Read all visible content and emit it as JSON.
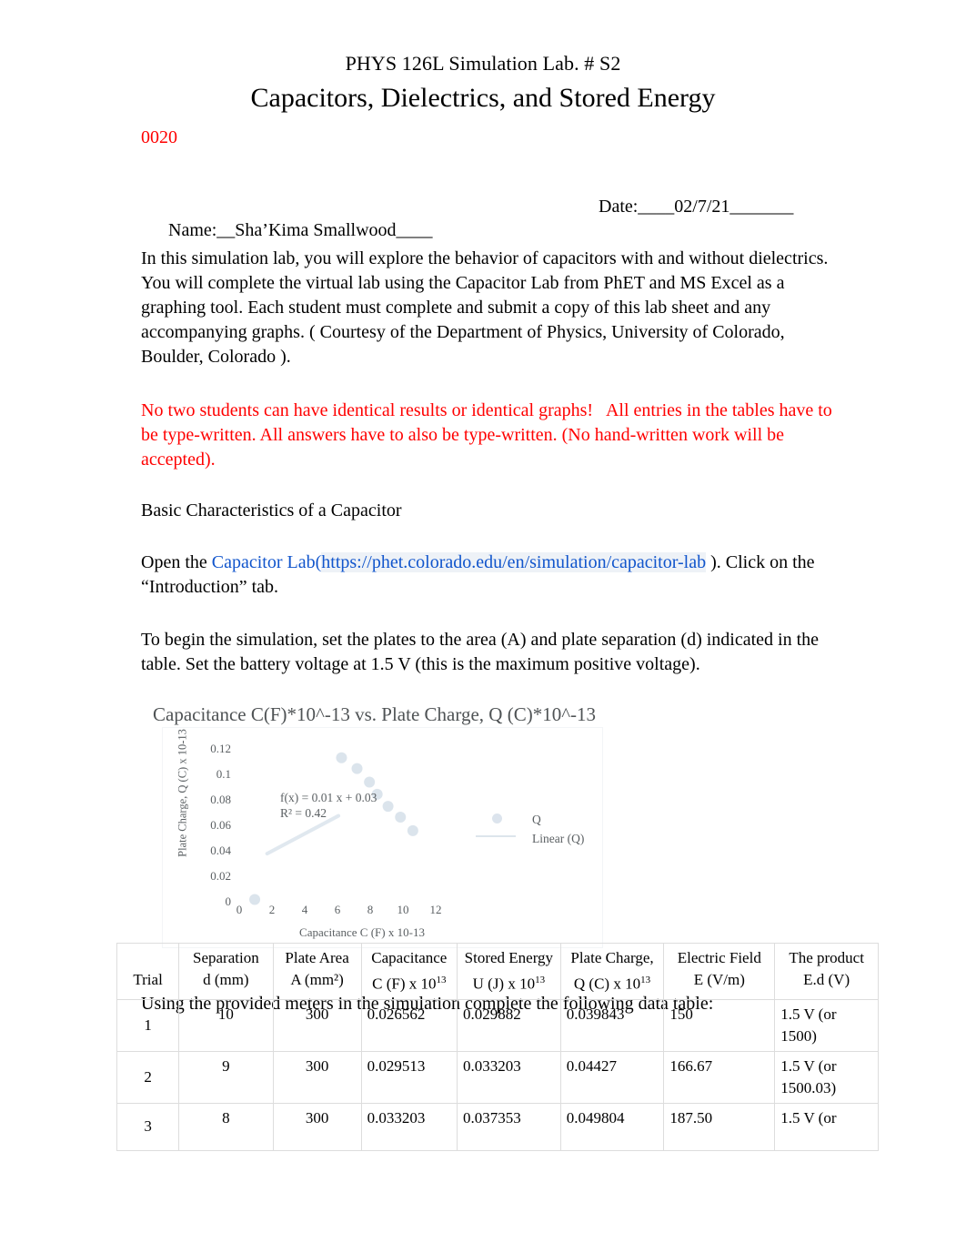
{
  "header": {
    "lab_line": "PHYS 126L Simulation Lab. # S2",
    "title": "Capacitors, Dielectrics, and Stored Energy",
    "course_code": "0020"
  },
  "identity": {
    "name_label": "Name:__Sha’Kima Smallwood____",
    "date_label": "Date:____02/7/21_______"
  },
  "intro": {
    "paragraph": "In this simulation lab, you will explore the behavior of capacitors with and without dielectrics.  You will complete the virtual lab using the Capacitor Lab from PhET and MS Excel as a graphing tool. Each student must complete and submit a copy of this lab sheet and any accompanying graphs. ( Courtesy of the Department of Physics, University of Colorado, Boulder, Colorado ).",
    "warning": "No two students can have identical results or identical graphs!   All entries in the tables have to be type-written. All answers have to also be type-written. (No hand-written work will be accepted).",
    "section_heading": "Basic Characteristics of a Capacitor",
    "open_prefix": "Open the ",
    "link_name": "Capacitor Lab",
    "link_open_paren": "(",
    "link_url": "https://phet.colorado.edu/en/simulation/capacitor-lab",
    "link_suffix": "   ). Click on the “Introduction” tab.",
    "setup": "To begin the simulation, set the plates to the area (A) and plate separation (d) indicated in the table. Set the battery voltage at 1.5 V (this is the maximum positive voltage)."
  },
  "chart_data": {
    "type": "scatter",
    "title": "Capacitance C(F)*10^-13 vs. Plate Charge, Q (C)*10^-13",
    "xlabel": "Capacitance C (F) x 10-13",
    "ylabel": "Plate Charge, Q (C) x 10-13",
    "xlim": [
      0,
      13
    ],
    "ylim": [
      0,
      0.12
    ],
    "xticks": [
      0,
      2,
      4,
      6,
      8,
      10,
      12
    ],
    "xtick_labels": [
      "0",
      "2",
      "4",
      "6",
      "8",
      "10",
      "12"
    ],
    "yticks": [
      0,
      0.02,
      0.04,
      0.06,
      0.08,
      0.1,
      0.12
    ],
    "ytick_labels": [
      "0",
      "0.02",
      "0.04",
      "0.06",
      "0.08",
      "0.1",
      "0.12"
    ],
    "grid": false,
    "legend_position": "right",
    "legend": [
      "Q",
      "Linear (Q)"
    ],
    "annotations": [
      "f(x) = 0.01 x + 0.03",
      "R² = 0.42"
    ],
    "fit": {
      "slope": 0.01,
      "intercept": 0.03,
      "r2": 0.42
    },
    "series": [
      {
        "name": "Q",
        "x": [
          6.6,
          7.6,
          8.4,
          8.9,
          9.6,
          10.4,
          11.2,
          1.0
        ],
        "y": [
          0.106,
          0.098,
          0.088,
          0.079,
          0.07,
          0.062,
          0.052,
          0.001
        ]
      }
    ],
    "trendline": {
      "name": "Linear (Q)",
      "x": [
        1.8,
        6.4
      ],
      "y": [
        0.035,
        0.063
      ]
    }
  },
  "table": {
    "intro": "Using the provided meters in the simulation complete the following data table:",
    "headers": [
      {
        "line1": "Trial",
        "line2": ""
      },
      {
        "line1": "Separation",
        "line2": "d  (mm)"
      },
      {
        "line1": "Plate Area",
        "line2": "A (mm²)"
      },
      {
        "line1": "Capacitance",
        "line2": "C (F) x 10",
        "sup": "13"
      },
      {
        "line1": "Stored Energy",
        "line2": "U (J) x 10",
        "sup": "13"
      },
      {
        "line1": "Plate Charge,",
        "line2": "Q (C) x 10",
        "sup": "13"
      },
      {
        "line1": "Electric Field",
        "line2": "E (V/m)"
      },
      {
        "line1": "The product",
        "line2": "E.d (V)"
      }
    ],
    "rows": [
      {
        "trial": "1",
        "separation": "10",
        "area": "300",
        "capacitance": "0.026562",
        "stored_energy": "0.029882",
        "plate_charge": "0.039843",
        "electric_field": "150",
        "product": "1.5 V (or 1500)"
      },
      {
        "trial": "2",
        "separation": "9",
        "area": "300",
        "capacitance": "0.029513",
        "stored_energy": "0.033203",
        "plate_charge": "0.04427",
        "electric_field": "166.67",
        "product": "1.5 V (or 1500.03)"
      },
      {
        "trial": "3",
        "separation": "8",
        "area": "300",
        "capacitance": "0.033203",
        "stored_energy": "0.037353",
        "plate_charge": "0.049804",
        "electric_field": "187.50",
        "product": "1.5 V (or"
      }
    ]
  },
  "colors": {
    "warning_red": "#ff0000",
    "link_blue": "#1155cc",
    "chart_gray": "#5a5f62",
    "marker_blue": "#cdd9e5"
  }
}
